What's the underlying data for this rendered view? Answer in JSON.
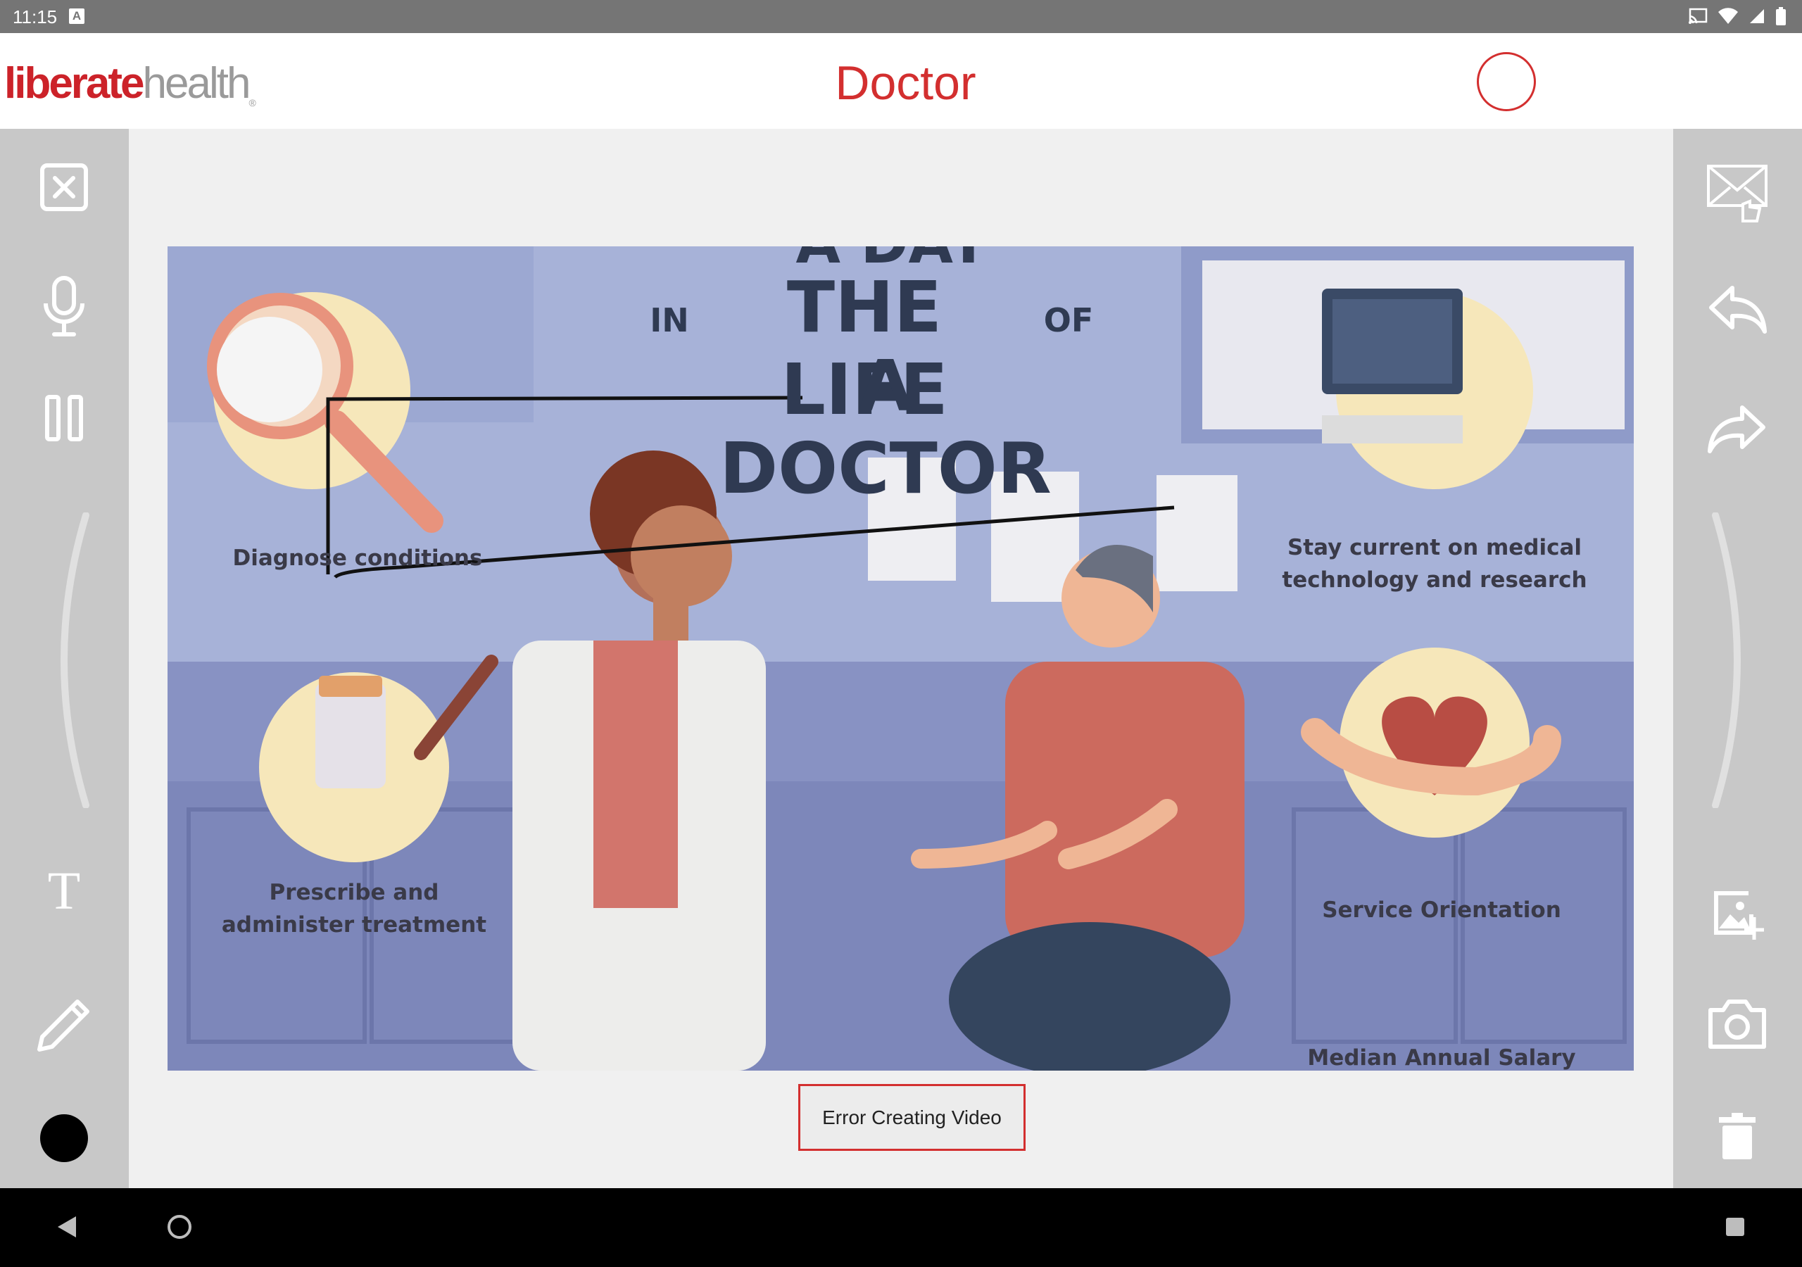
{
  "status_bar": {
    "time": "11:15",
    "keyboard_indicator": "A"
  },
  "header": {
    "logo_bold": "liberate",
    "logo_light": "health",
    "logo_mark": "®",
    "title": "Doctor"
  },
  "left_toolbar": {
    "icons": [
      "close-box-icon",
      "microphone-icon",
      "pause-icon",
      "previous-chevron-icon",
      "text-tool-icon",
      "pencil-icon",
      "color-swatch-icon"
    ],
    "text_tool_glyph": "T",
    "selected_color": "#000000"
  },
  "right_toolbar": {
    "icons": [
      "email-send-icon",
      "undo-icon",
      "redo-icon",
      "next-chevron-icon",
      "add-image-icon",
      "camera-icon",
      "trash-icon"
    ]
  },
  "infographic": {
    "title_top": "A DAY",
    "title_in": "IN",
    "title_main": "THE LIFE",
    "title_of": "OF",
    "title_bottom": "A DOCTOR",
    "label_diagnose": "Diagnose conditions",
    "label_stay_current_1": "Stay current on medical",
    "label_stay_current_2": "technology and research",
    "label_prescribe_1": "Prescribe and",
    "label_prescribe_2": "administer treatment",
    "label_service": "Service Orientation",
    "label_salary": "Median Annual Salary"
  },
  "toast": {
    "message": "Error Creating Video"
  },
  "colors": {
    "brand_red": "#cc2229",
    "toolbar_gray": "#c8c8c8",
    "ink": "#111111"
  }
}
